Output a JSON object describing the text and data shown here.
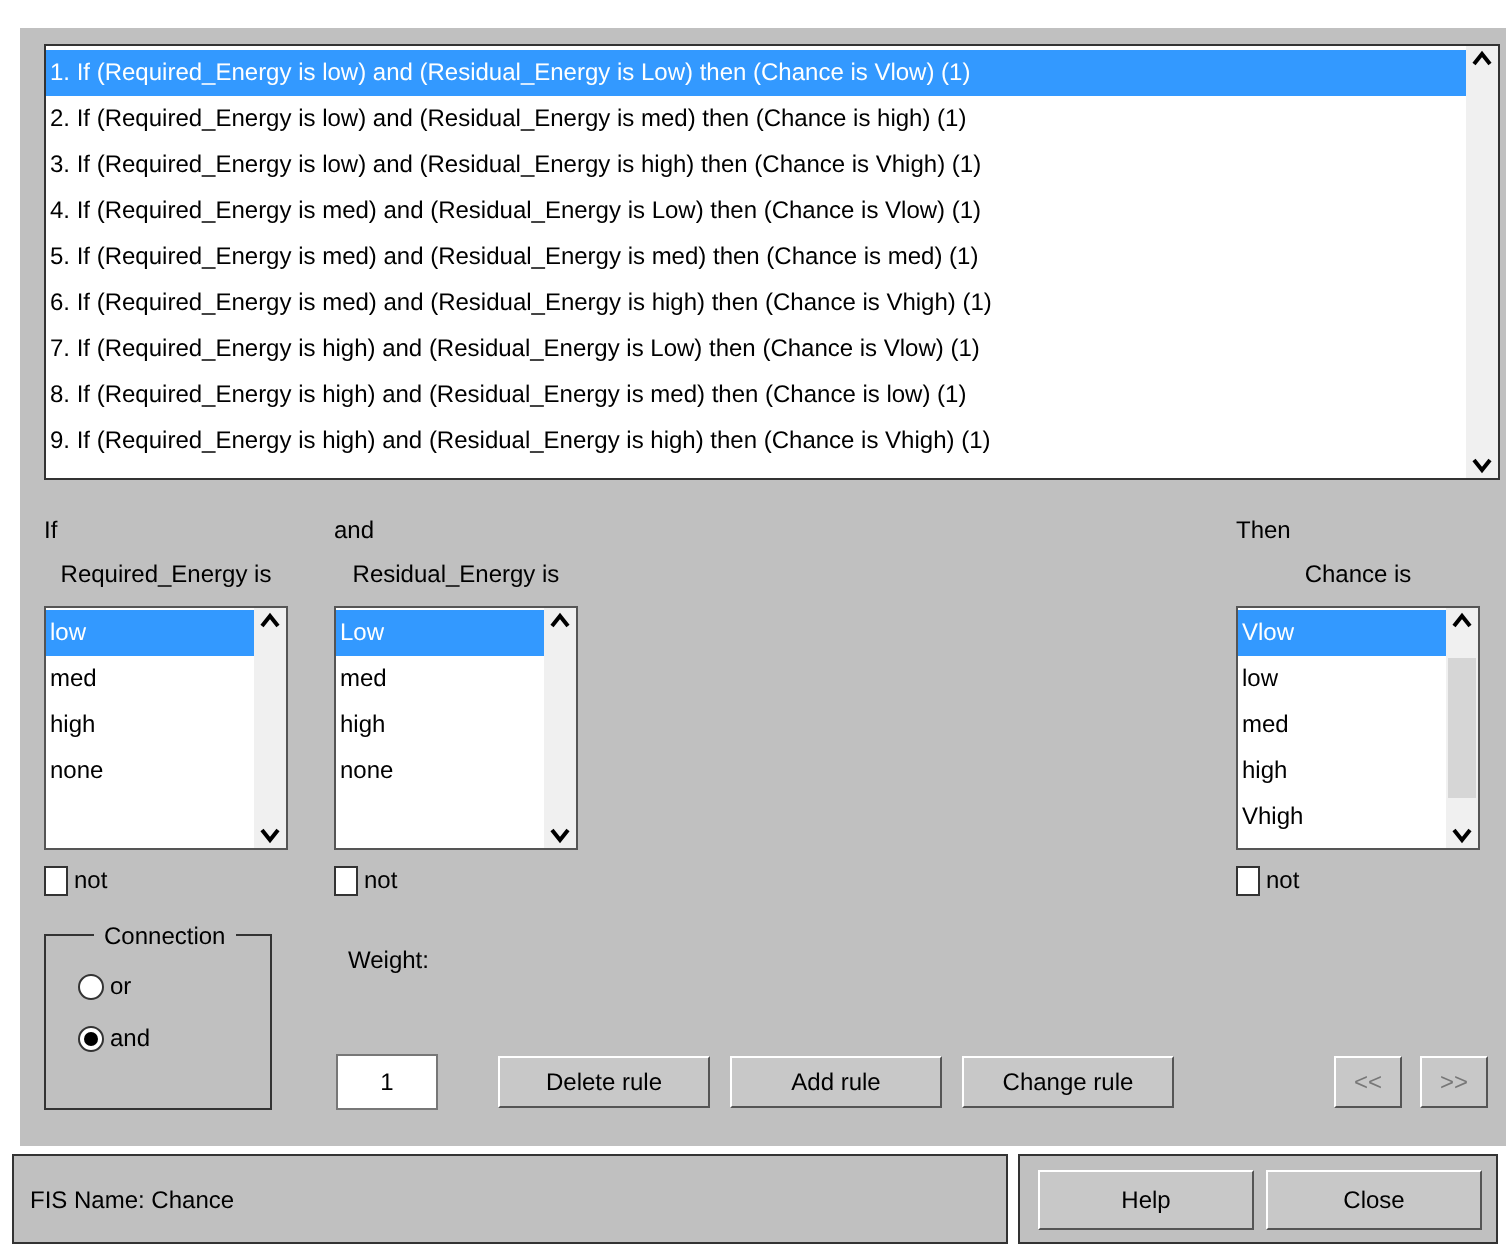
{
  "rules": [
    {
      "text": "1. If (Required_Energy is low) and (Residual_Energy is Low) then (Chance is Vlow) (1)",
      "selected": true
    },
    {
      "text": "2. If (Required_Energy is low) and (Residual_Energy is med) then (Chance is high) (1)",
      "selected": false
    },
    {
      "text": "3. If (Required_Energy is low) and (Residual_Energy is high) then (Chance is Vhigh) (1)",
      "selected": false
    },
    {
      "text": "4. If (Required_Energy is med) and (Residual_Energy is Low) then (Chance is Vlow) (1)",
      "selected": false
    },
    {
      "text": "5. If (Required_Energy is med) and (Residual_Energy is med) then (Chance is med) (1)",
      "selected": false
    },
    {
      "text": "6. If (Required_Energy is med) and (Residual_Energy is high) then (Chance is Vhigh) (1)",
      "selected": false
    },
    {
      "text": "7. If (Required_Energy is high) and (Residual_Energy is Low) then (Chance is Vlow) (1)",
      "selected": false
    },
    {
      "text": "8. If (Required_Energy is high) and (Residual_Energy is med) then (Chance is low) (1)",
      "selected": false
    },
    {
      "text": "9. If (Required_Energy is high) and (Residual_Energy is high) then (Chance is Vhigh) (1)",
      "selected": false
    }
  ],
  "inputs": [
    {
      "lead": "If",
      "label": "Required_Energy is",
      "items": [
        {
          "label": "low",
          "selected": true
        },
        {
          "label": "med",
          "selected": false
        },
        {
          "label": "high",
          "selected": false
        },
        {
          "label": "none",
          "selected": false
        }
      ],
      "not_label": "not",
      "not_checked": false
    },
    {
      "lead": "and",
      "label": "Residual_Energy is",
      "items": [
        {
          "label": "Low",
          "selected": true
        },
        {
          "label": "med",
          "selected": false
        },
        {
          "label": "high",
          "selected": false
        },
        {
          "label": "none",
          "selected": false
        }
      ],
      "not_label": "not",
      "not_checked": false
    }
  ],
  "output": {
    "lead": "Then",
    "label": "Chance is",
    "items": [
      {
        "label": "Vlow",
        "selected": true
      },
      {
        "label": "low",
        "selected": false
      },
      {
        "label": "med",
        "selected": false
      },
      {
        "label": "high",
        "selected": false
      },
      {
        "label": "Vhigh",
        "selected": false
      }
    ],
    "not_label": "not",
    "not_checked": false
  },
  "connection": {
    "title": "Connection",
    "options": [
      {
        "label": "or",
        "selected": false
      },
      {
        "label": "and",
        "selected": true
      }
    ]
  },
  "weight": {
    "label": "Weight:",
    "value": "1"
  },
  "rule_buttons": [
    "Delete rule",
    "Add rule",
    "Change rule"
  ],
  "nav_buttons": [
    "<<",
    ">>"
  ],
  "status": "FIS Name: Chance",
  "bottom_buttons": [
    "Help",
    "Close"
  ]
}
